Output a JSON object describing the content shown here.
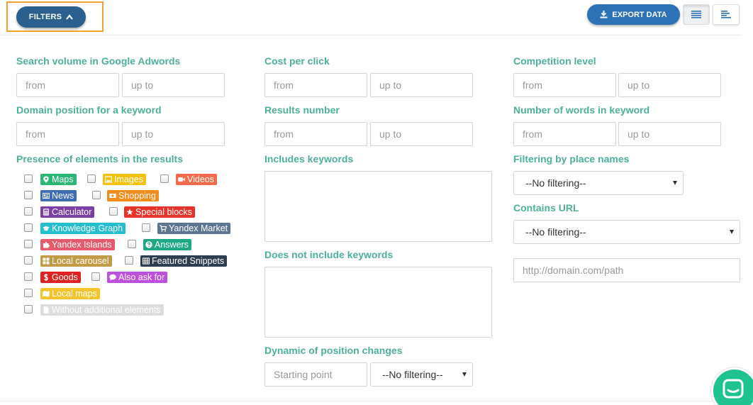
{
  "toolbar": {
    "filters_label": "FILTERS",
    "export_label": "EXPORT DATA",
    "icons": {
      "filters": "chevron-up-icon",
      "export": "download-icon",
      "view_list": "list-view-icon",
      "view_compact": "align-left-icon"
    }
  },
  "columns": {
    "search_volume": {
      "label": "Search volume in Google Adwords",
      "from_placeholder": "from",
      "to_placeholder": "up to"
    },
    "domain_position": {
      "label": "Domain position for a keyword",
      "from_placeholder": "from",
      "to_placeholder": "up to"
    },
    "presence": {
      "label": "Presence of elements in the results"
    },
    "cpc": {
      "label": "Cost per click",
      "from_placeholder": "from",
      "to_placeholder": "up to"
    },
    "results_number": {
      "label": "Results number",
      "from_placeholder": "from",
      "to_placeholder": "up to"
    },
    "includes": {
      "label": "Includes keywords"
    },
    "not_includes": {
      "label": "Does not include keywords"
    },
    "dynamic": {
      "label": "Dynamic of position changes",
      "start_placeholder": "Starting point",
      "select_value": "--No filtering--"
    },
    "competition": {
      "label": "Competition level",
      "from_placeholder": "from",
      "to_placeholder": "up to"
    },
    "words_count": {
      "label": "Number of words in keyword",
      "from_placeholder": "from",
      "to_placeholder": "up to"
    },
    "place_names": {
      "label": "Filtering by place names",
      "select_value": "--No filtering--"
    },
    "contains_url": {
      "label": "Contains URL",
      "select_value": "--No filtering--",
      "url_placeholder": "http://domain.com/path"
    }
  },
  "elements": [
    {
      "label": "Maps",
      "color": "#2bb673",
      "icon": "map-marker-icon"
    },
    {
      "label": "Images",
      "color": "#f4c20d",
      "icon": "image-icon"
    },
    {
      "label": "Videos",
      "color": "#f26a4b",
      "icon": "video-camera-icon"
    },
    {
      "label": "News",
      "color": "#3d6db5",
      "icon": "newspaper-icon"
    },
    {
      "label": "Shopping",
      "color": "#f08c1a",
      "icon": "money-icon"
    },
    {
      "label": "Calculator",
      "color": "#7b3fa5",
      "icon": "calculator-icon"
    },
    {
      "label": "Special blocks",
      "color": "#e8332a",
      "icon": "star-icon"
    },
    {
      "label": "Knowledge Graph",
      "color": "#23bfcf",
      "icon": "graduation-cap-icon"
    },
    {
      "label": "Yandex Market",
      "color": "#5d7590",
      "icon": "shopping-cart-icon"
    },
    {
      "label": "Yandex Islands",
      "color": "#e55968",
      "icon": "puzzle-icon"
    },
    {
      "label": "Answers",
      "color": "#1ea886",
      "icon": "question-circle-icon"
    },
    {
      "label": "Local carousel",
      "color": "#c39a45",
      "icon": "grid-icon"
    },
    {
      "label": "Featured Snippets",
      "color": "#2c3e50",
      "icon": "table-icon"
    },
    {
      "label": "Goods",
      "color": "#dd2222",
      "icon": "dollar-icon"
    },
    {
      "label": "Also ask for",
      "color": "#c04fe0",
      "icon": "comment-icon"
    },
    {
      "label": "Local maps",
      "color": "#f5c32b",
      "icon": "map-icon"
    },
    {
      "label": "Without additional elements",
      "color": "#dddddd",
      "icon": "file-icon"
    }
  ],
  "chat": {
    "icon": "chat-icon",
    "color": "#1fc38f"
  }
}
